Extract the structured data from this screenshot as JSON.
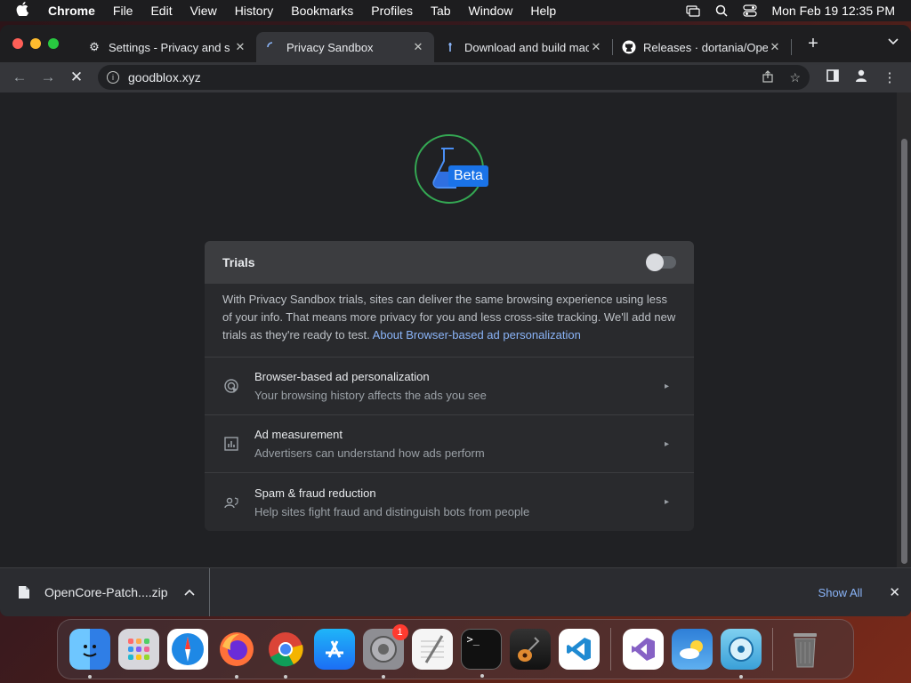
{
  "menubar": {
    "app_name": "Chrome",
    "items": [
      "File",
      "Edit",
      "View",
      "History",
      "Bookmarks",
      "Profiles",
      "Tab",
      "Window",
      "Help"
    ],
    "clock": "Mon Feb 19  12:35 PM"
  },
  "tabs": [
    {
      "title": "Settings - Privacy and s",
      "icon": "gear-icon"
    },
    {
      "title": "Privacy Sandbox",
      "icon": "loading-spinner-icon",
      "active": true
    },
    {
      "title": "Download and build mac",
      "icon": "pin-icon"
    },
    {
      "title": "Releases · dortania/Ope",
      "icon": "github-icon"
    }
  ],
  "toolbar": {
    "url": "goodblox.xyz"
  },
  "page": {
    "badge": "Beta",
    "card": {
      "header": "Trials",
      "toggle_on": false,
      "description": "With Privacy Sandbox trials, sites can deliver the same browsing experience using less of your info. That means more privacy for you and less cross-site tracking. We'll add new trials as they're ready to test.",
      "link": "About Browser-based ad personalization",
      "rows": [
        {
          "title": "Browser-based ad personalization",
          "subtitle": "Your browsing history affects the ads you see",
          "icon": "ad-target-icon"
        },
        {
          "title": "Ad measurement",
          "subtitle": "Advertisers can understand how ads perform",
          "icon": "bar-chart-icon"
        },
        {
          "title": "Spam & fraud reduction",
          "subtitle": "Help sites fight fraud and distinguish bots from people",
          "icon": "person-shield-icon"
        }
      ]
    }
  },
  "download_shelf": {
    "file_name": "OpenCore-Patch....zip",
    "show_all": "Show All"
  },
  "dock": {
    "apps": [
      {
        "name": "finder",
        "color": "#3a8ee6"
      },
      {
        "name": "launchpad",
        "color": "#c9c9ce"
      },
      {
        "name": "safari",
        "color": "#1e88e5"
      },
      {
        "name": "firefox",
        "color": "#ff7139"
      },
      {
        "name": "chrome",
        "color": "#ffffff"
      },
      {
        "name": "app-store",
        "color": "#1c8cf5"
      },
      {
        "name": "system-settings",
        "color": "#8e8e93",
        "badge": "1"
      },
      {
        "name": "textedit",
        "color": "#f5f5f5"
      },
      {
        "name": "terminal",
        "color": "#111111"
      },
      {
        "name": "garageband",
        "color": "#5a3a20"
      },
      {
        "name": "vscode",
        "color": "#ffffff"
      },
      {
        "name": "visual-studio",
        "color": "#ffffff"
      },
      {
        "name": "weather",
        "color": "#3d8fe0"
      },
      {
        "name": "disk-utility",
        "color": "#5bb8e8"
      },
      {
        "name": "trash",
        "color": "#555555"
      }
    ]
  }
}
